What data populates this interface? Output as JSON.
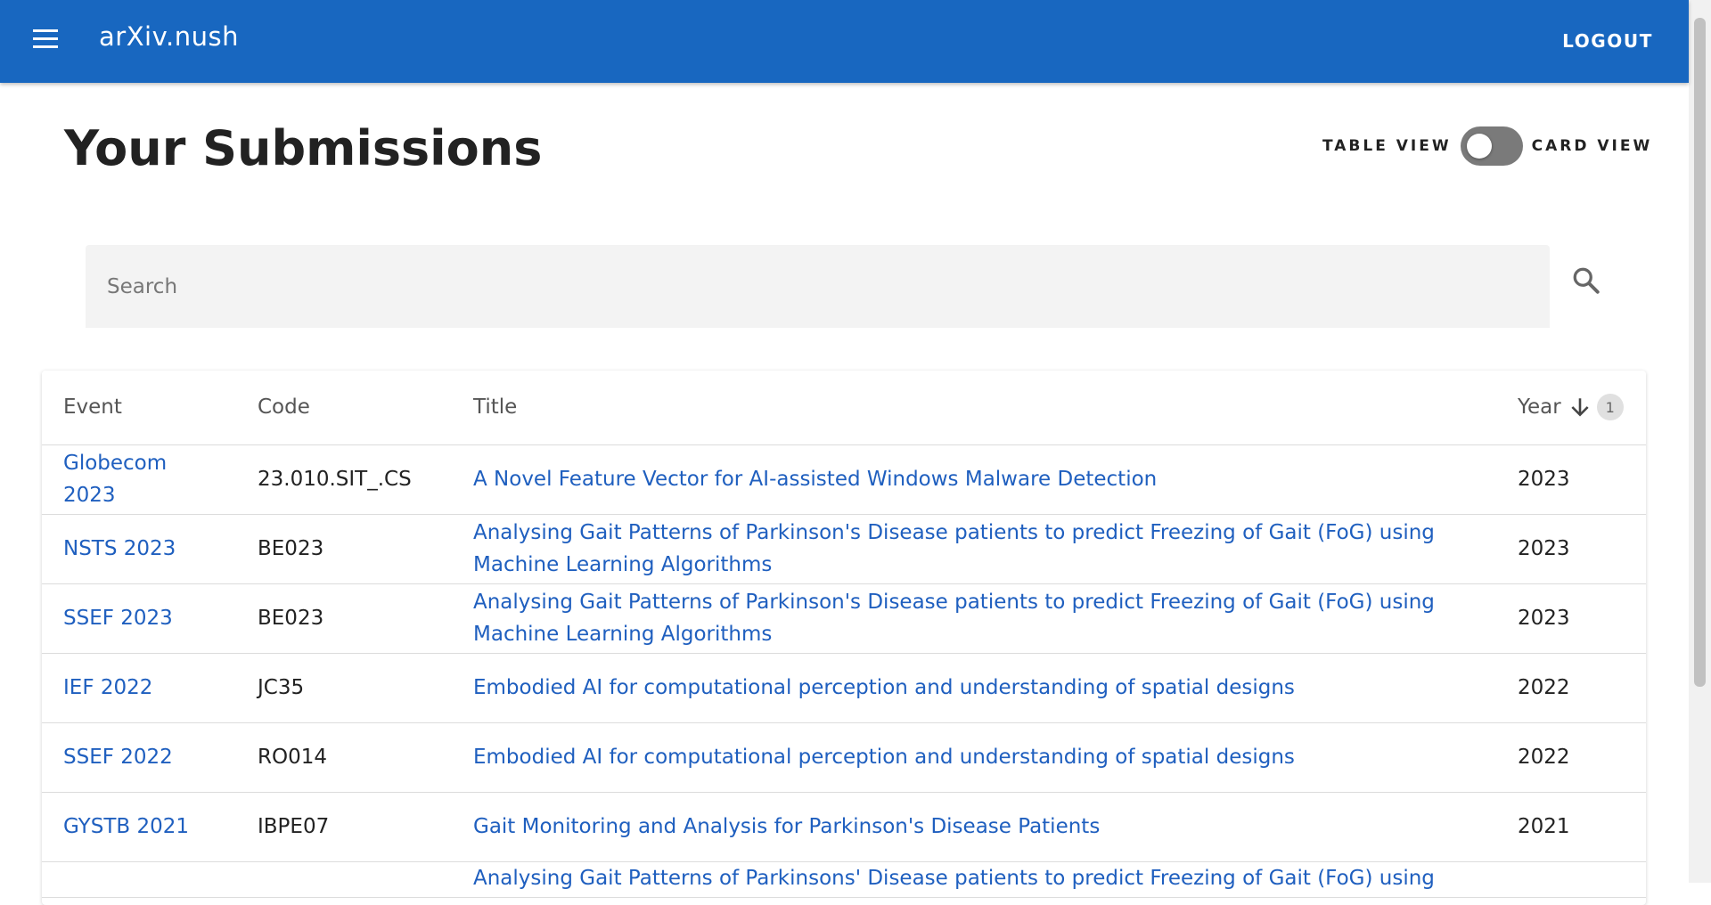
{
  "app": {
    "title": "arXiv.nush",
    "logout_label": "LOGOUT",
    "accent": "#1867c0",
    "link_color": "#1f5fbf"
  },
  "page": {
    "title": "Your Submissions"
  },
  "view_toggle": {
    "left_label": "TABLE VIEW",
    "right_label": "CARD VIEW",
    "checked": false
  },
  "search": {
    "placeholder": "Search",
    "value": "",
    "icon": "search-icon"
  },
  "table": {
    "headers": {
      "event": "Event",
      "code": "Code",
      "title": "Title",
      "year": "Year",
      "sort_order": "1",
      "sort_icon": "arrow-down-icon"
    },
    "rows": [
      {
        "event": "Globecom 2023",
        "code": "23.010.SIT_.CS",
        "title": "A Novel Feature Vector for AI-assisted Windows Malware Detection",
        "year": "2023"
      },
      {
        "event": "NSTS 2023",
        "code": "BE023",
        "title": "Analysing Gait Patterns of Parkinson's Disease patients to predict Freezing of Gait (FoG) using Machine Learning Algorithms",
        "year": "2023"
      },
      {
        "event": "SSEF 2023",
        "code": "BE023",
        "title": "Analysing Gait Patterns of Parkinson's Disease patients to predict Freezing of Gait (FoG) using Machine Learning Algorithms",
        "year": "2023"
      },
      {
        "event": "IEF 2022",
        "code": "JC35",
        "title": "Embodied AI for computational perception and understanding of spatial designs",
        "year": "2022"
      },
      {
        "event": "SSEF 2022",
        "code": "RO014",
        "title": "Embodied AI for computational perception and understanding of spatial designs",
        "year": "2022"
      },
      {
        "event": "GYSTB 2021",
        "code": "IBPE07",
        "title": "Gait Monitoring and Analysis for Parkinson's Disease Patients",
        "year": "2021"
      }
    ],
    "partial_row": {
      "title": "Analysing Gait Patterns of Parkinsons' Disease patients to predict Freezing of Gait (FoG) using"
    }
  }
}
